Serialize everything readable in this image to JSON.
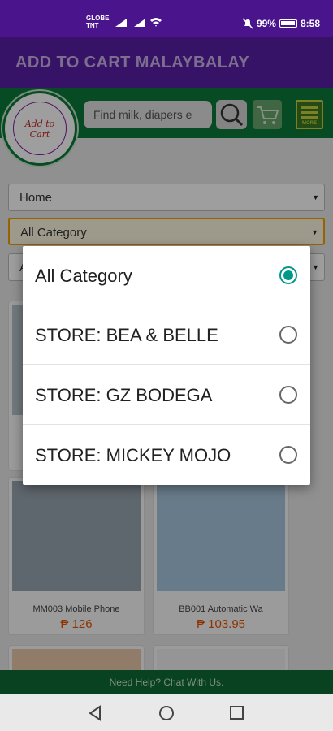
{
  "status_bar": {
    "carrier_line1": "GLOBE",
    "carrier_line2": "TNT",
    "battery": "99%",
    "time": "8:58"
  },
  "app": {
    "title": "ADD TO CART MALAYBALAY"
  },
  "header": {
    "search_placeholder": "Find milk, diapers e",
    "menu_label": "MORE"
  },
  "filters": {
    "location": "Home",
    "category": "All Category",
    "sort": "A"
  },
  "products": [
    {
      "name": "MM003 Mobile Phone",
      "price": "₱ 126"
    },
    {
      "name": "BB001 Automatic Wa",
      "price": "₱ 103.95"
    }
  ],
  "footer": {
    "chat": "Need Help? Chat With Us."
  },
  "dialog": {
    "options": [
      {
        "label": "All Category",
        "selected": true
      },
      {
        "label": "STORE: BEA & BELLE",
        "selected": false
      },
      {
        "label": "STORE: GZ BODEGA",
        "selected": false
      },
      {
        "label": "STORE: MICKEY MOJO",
        "selected": false
      }
    ]
  },
  "colors": {
    "status_purple": "#4a148c",
    "title_purple": "#5a1fa8",
    "brand_green": "#0a7a3a",
    "radio_teal": "#009688",
    "price_orange": "#e65100"
  }
}
